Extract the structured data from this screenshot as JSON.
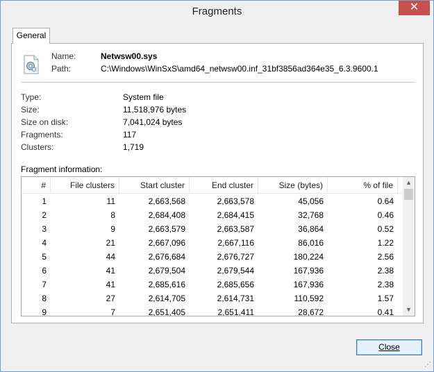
{
  "window": {
    "title": "Fragments",
    "close_glyph": "✕"
  },
  "tabs": [
    {
      "label": "General"
    }
  ],
  "file": {
    "icon": "system-file-gear-icon",
    "name_label": "Name:",
    "name": "Netwsw00.sys",
    "path_label": "Path:",
    "path": "C:\\Windows\\WinSxS\\amd64_netwsw00.inf_31bf3856ad364e35_6.3.9600.1"
  },
  "properties": [
    {
      "label": "Type:",
      "value": "System file"
    },
    {
      "label": "Size:",
      "value": "11,518,976 bytes"
    },
    {
      "label": "Size on disk:",
      "value": "7,041,024 bytes"
    },
    {
      "label": "Fragments:",
      "value": "117"
    },
    {
      "label": "Clusters:",
      "value": "1,719"
    }
  ],
  "fragment_info": {
    "label": "Fragment information:",
    "columns": [
      "#",
      "File clusters",
      "Start cluster",
      "End cluster",
      "Size (bytes)",
      "% of file"
    ],
    "rows": [
      [
        "1",
        "11",
        "2,663,568",
        "2,663,578",
        "45,056",
        "0.64"
      ],
      [
        "2",
        "8",
        "2,684,408",
        "2,684,415",
        "32,768",
        "0.46"
      ],
      [
        "3",
        "9",
        "2,663,579",
        "2,663,587",
        "36,864",
        "0.52"
      ],
      [
        "4",
        "21",
        "2,667,096",
        "2,667,116",
        "86,016",
        "1.22"
      ],
      [
        "5",
        "44",
        "2,676,684",
        "2,676,727",
        "180,224",
        "2.56"
      ],
      [
        "6",
        "41",
        "2,679,504",
        "2,679,544",
        "167,936",
        "2.38"
      ],
      [
        "7",
        "41",
        "2,685,616",
        "2,685,656",
        "167,936",
        "2.38"
      ],
      [
        "8",
        "27",
        "2,614,705",
        "2,614,731",
        "110,592",
        "1.57"
      ],
      [
        "9",
        "7",
        "2,651,405",
        "2,651,411",
        "28,672",
        "0.41"
      ]
    ]
  },
  "buttons": {
    "close_label": "Close"
  },
  "colors": {
    "close_button_accent": "#3c7fb1",
    "title_close_bg": "#c7504b"
  }
}
